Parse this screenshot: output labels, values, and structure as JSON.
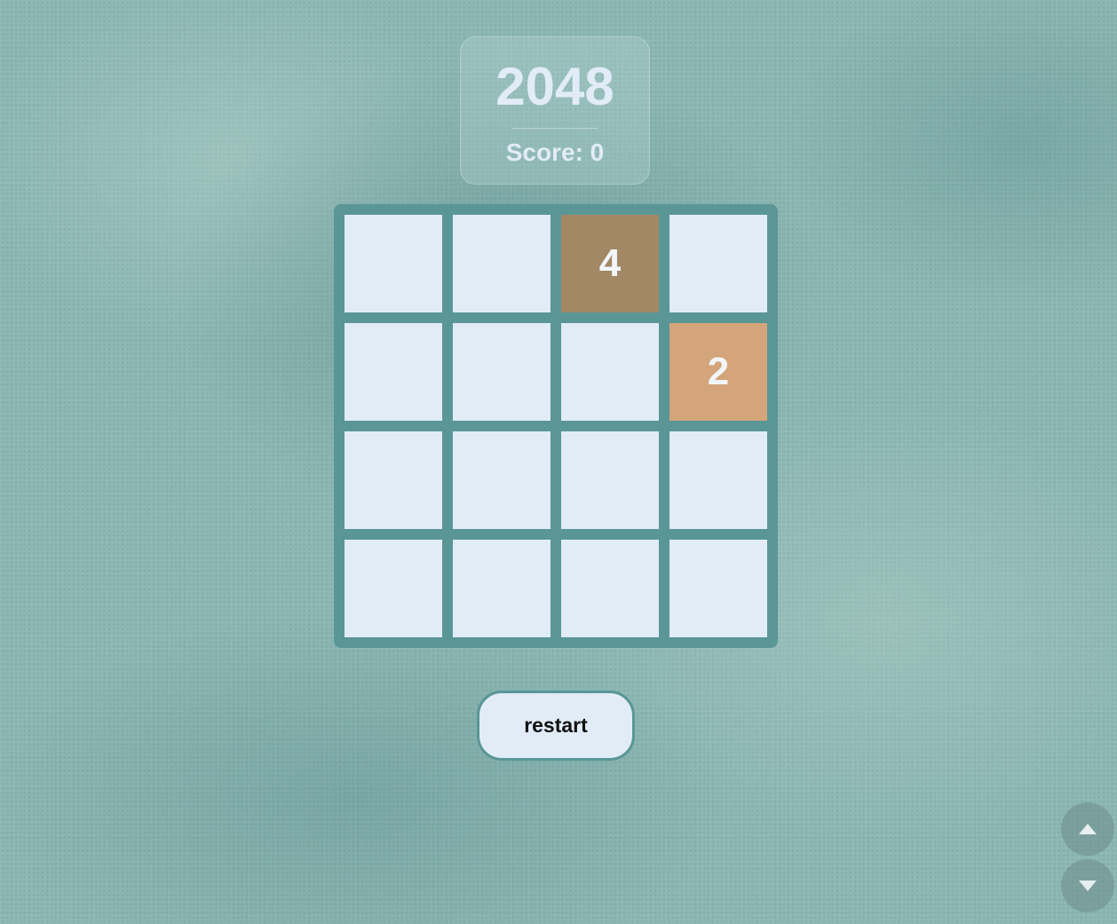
{
  "header": {
    "title": "2048",
    "score_label": "Score: 0"
  },
  "board": {
    "cells": [
      [
        "",
        "",
        "4",
        ""
      ],
      [
        "",
        "",
        "",
        "2"
      ],
      [
        "",
        "",
        "",
        ""
      ],
      [
        "",
        "",
        "",
        ""
      ]
    ],
    "tile_colors": {
      "empty": "#e1ecf7",
      "2": "#d4a57a",
      "4": "#a38866"
    }
  },
  "controls": {
    "restart_label": "restart",
    "scroll_up_icon": "triangle-up-icon",
    "scroll_down_icon": "triangle-down-icon"
  }
}
